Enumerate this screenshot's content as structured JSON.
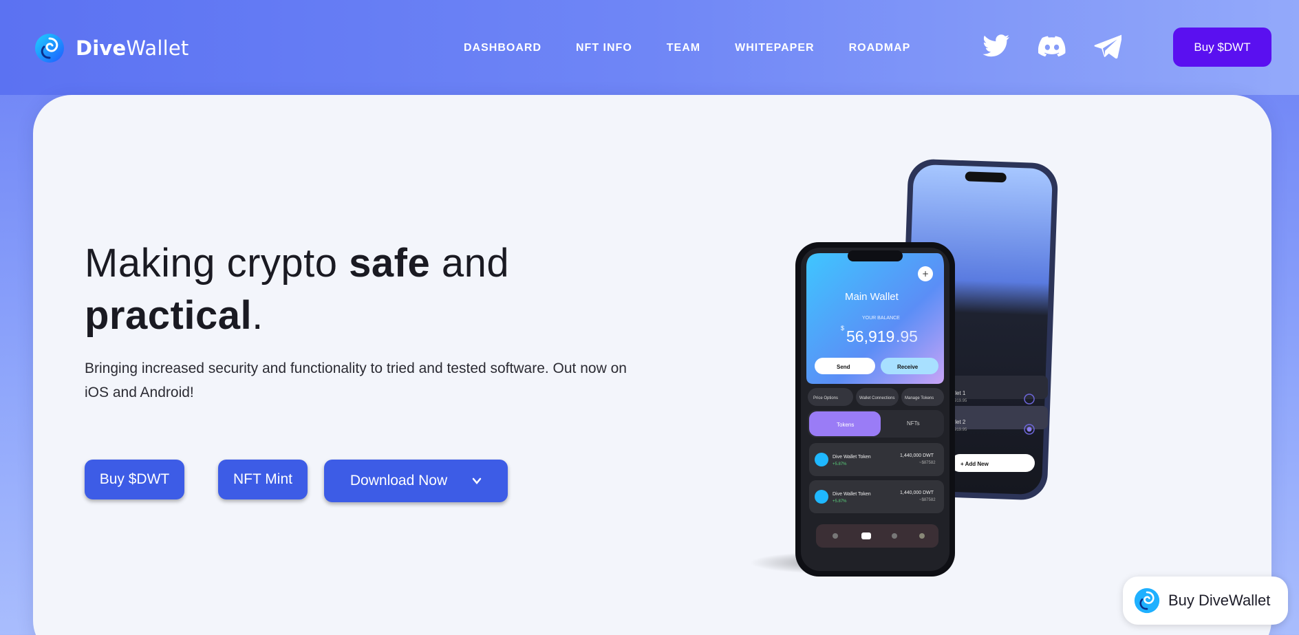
{
  "header": {
    "logo_bold": "Dive",
    "logo_rest": "Wallet",
    "nav": [
      "DASHBOARD",
      "NFT INFO",
      "TEAM",
      "WHITEPAPER",
      "ROADMAP"
    ],
    "socials": [
      "twitter-icon",
      "discord-icon",
      "telegram-icon"
    ],
    "buy_label": "Buy $DWT"
  },
  "hero": {
    "headline_part1": "Making crypto ",
    "headline_bold1": "safe",
    "headline_part2": " and",
    "headline_bold2": "practical",
    "headline_end": ".",
    "subtext": "Bringing increased security and functionality to tried and tested software. Out now on iOS and Android!",
    "buttons": {
      "buy": "Buy $DWT",
      "mint": "NFT Mint",
      "download": "Download Now"
    }
  },
  "phone": {
    "wallet_title": "Main Wallet",
    "balance_label": "YOUR BALANCE",
    "balance_currency": "$",
    "balance_main": "56,919",
    "balance_cents": ".95",
    "send": "Send",
    "receive": "Receive",
    "options": [
      "Price Options",
      "Wallet Connections",
      "Manage Tokens"
    ],
    "tabs": [
      "Tokens",
      "NFTs"
    ],
    "tokens": [
      {
        "name": "Dive Wallet Token",
        "change": "+5.87%",
        "amount": "1,440,000 DWT",
        "value": "~$87582"
      },
      {
        "name": "Dive Wallet Token",
        "change": "+5.87%",
        "amount": "1,440,000 DWT",
        "value": "~$87582"
      }
    ],
    "back_wallets": [
      {
        "label": "allet 1",
        "sub": "6,919.95"
      },
      {
        "label": "allet 2",
        "sub": "9,919.95"
      }
    ],
    "add_new": "+ Add New"
  },
  "widget": {
    "label": "Buy DiveWallet"
  },
  "colors": {
    "accent": "#3d5ce6",
    "buy_top": "#5a10f0",
    "card_bg": "#f3f5fb"
  }
}
